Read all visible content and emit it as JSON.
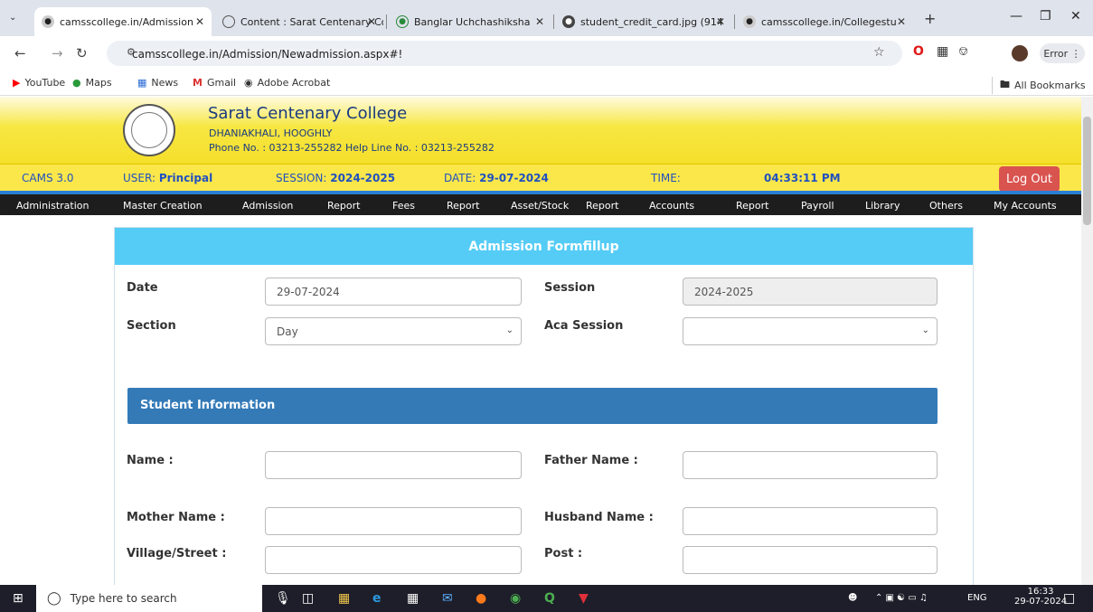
{
  "browser": {
    "tabs": [
      {
        "title": "camsscollege.in/Admission"
      },
      {
        "title": "Content : Sarat Centenary Co"
      },
      {
        "title": "Banglar Uchchashiksha"
      },
      {
        "title": "student_credit_card.jpg (914"
      },
      {
        "title": "camsscollege.in/Collegestu"
      }
    ],
    "url": "camsscollege.in/Admission/Newadmission.aspx#!",
    "error_label": "Error",
    "bookmarks": [
      "YouTube",
      "Maps",
      "News",
      "Gmail",
      "Adobe Acrobat"
    ],
    "all_bookmarks": "All Bookmarks"
  },
  "college": {
    "name": "Sarat Centenary College",
    "address": "DHANIAKHALI, HOOGHLY",
    "phone": "Phone No. : 03213-255282  Help Line No. : 03213-255282"
  },
  "infobar": {
    "version": "CAMS 3.0",
    "user_label": "USER:",
    "user": "Principal",
    "session_label": "SESSION:",
    "session": "2024-2025",
    "date_label": "DATE:",
    "date": "29-07-2024",
    "time_label": "TIME:",
    "time": "04:33:11 PM",
    "logout": "Log Out"
  },
  "menu": [
    "Administration",
    "Master Creation",
    "Admission",
    "Report",
    "Fees",
    "Report",
    "Asset/Stock",
    "Report",
    "Accounts",
    "Report",
    "Payroll",
    "Library",
    "Others",
    "My Accounts"
  ],
  "form": {
    "title": "Admission Formfillup",
    "date_label": "Date",
    "date_value": "29-07-2024",
    "session_label": "Session",
    "session_value": "2024-2025",
    "section_label": "Section",
    "section_value": "Day",
    "aca_session_label": "Aca Session",
    "aca_session_value": "",
    "student_info": "Student Information",
    "name_label": "Name :",
    "father_label": "Father Name :",
    "mother_label": "Mother Name :",
    "husband_label": "Husband Name :",
    "village_label": "Village/Street :",
    "post_label": "Post :"
  },
  "taskbar": {
    "search_placeholder": "Type here to search",
    "lang": "ENG",
    "time": "16:33",
    "date": "29-07-2024"
  }
}
